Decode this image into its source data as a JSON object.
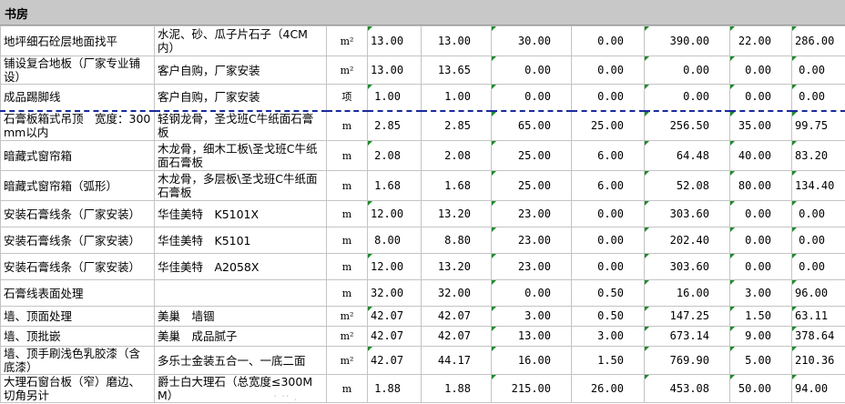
{
  "section_title": "书房",
  "rows": [
    {
      "name": "地坪细石砼层地面找平",
      "material": "水泥、砂、瓜子片石子（4CM内）",
      "unit": "m²",
      "c1": "13.00",
      "c2": "13.00",
      "c3": "30.00",
      "c4": "0.00",
      "c5": "390.00",
      "c6": "22.00",
      "c7": "286.00"
    },
    {
      "name": "铺设复合地板（厂家专业铺设）",
      "material": "客户自购，厂家安装",
      "unit": "m²",
      "c1": "13.00",
      "c2": "13.65",
      "c3": "0.00",
      "c4": "0.00",
      "c5": "0.00",
      "c6": "0.00",
      "c7": "0.00"
    },
    {
      "name": "成品踢脚线",
      "material": "客户自购，厂家安装",
      "unit": "项",
      "c1": "1.00",
      "c2": "1.00",
      "c3": "0.00",
      "c4": "0.00",
      "c5": "0.00",
      "c6": "0.00",
      "c7": "0.00"
    },
    {
      "name": "石膏板箱式吊顶　宽度：300mm以内",
      "material": "轻钢龙骨，圣戈班C牛纸面石膏板",
      "unit": "m",
      "c1": "2.85",
      "c2": "2.85",
      "c3": "65.00",
      "c4": "25.00",
      "c5": "256.50",
      "c6": "35.00",
      "c7": "99.75"
    },
    {
      "name": "暗藏式窗帘箱",
      "material": "木龙骨，细木工板\\圣戈班C牛纸面石膏板",
      "unit": "m",
      "c1": "2.08",
      "c2": "2.08",
      "c3": "25.00",
      "c4": "6.00",
      "c5": "64.48",
      "c6": "40.00",
      "c7": "83.20"
    },
    {
      "name": "暗藏式窗帘箱（弧形）",
      "material": "木龙骨，多层板\\圣戈班C牛纸面石膏板",
      "unit": "m",
      "c1": "1.68",
      "c2": "1.68",
      "c3": "25.00",
      "c4": "6.00",
      "c5": "52.08",
      "c6": "80.00",
      "c7": "134.40"
    },
    {
      "name": "安装石膏线条（厂家安装）",
      "material": "华佳美特　K5101X",
      "unit": "m",
      "c1": "12.00",
      "c2": "13.20",
      "c3": "23.00",
      "c4": "0.00",
      "c5": "303.60",
      "c6": "0.00",
      "c7": "0.00"
    },
    {
      "name": "安装石膏线条（厂家安装）",
      "material": "华佳美特　K5101",
      "unit": "m",
      "c1": "8.00",
      "c2": "8.80",
      "c3": "23.00",
      "c4": "0.00",
      "c5": "202.40",
      "c6": "0.00",
      "c7": "0.00"
    },
    {
      "name": "安装石膏线条（厂家安装）",
      "material": "华佳美特　A2058X",
      "unit": "m",
      "c1": "12.00",
      "c2": "13.20",
      "c3": "23.00",
      "c4": "0.00",
      "c5": "303.60",
      "c6": "0.00",
      "c7": "0.00"
    },
    {
      "name": "石膏线表面处理",
      "material": "",
      "unit": "m",
      "c1": "32.00",
      "c2": "32.00",
      "c3": "0.00",
      "c4": "0.50",
      "c5": "16.00",
      "c6": "3.00",
      "c7": "96.00"
    },
    {
      "name": "墙、顶面处理",
      "material": "美巢　墙锢",
      "unit": "m²",
      "c1": "42.07",
      "c2": "42.07",
      "c3": "3.00",
      "c4": "0.50",
      "c5": "147.25",
      "c6": "1.50",
      "c7": "63.11"
    },
    {
      "name": "墙、顶批嵌",
      "material": "美巢　成品腻子",
      "unit": "m²",
      "c1": "42.07",
      "c2": "42.07",
      "c3": "13.00",
      "c4": "3.00",
      "c5": "673.14",
      "c6": "9.00",
      "c7": "378.64"
    },
    {
      "name": "墙、顶手刷浅色乳胶漆（含底漆）",
      "material": "多乐士金装五合一、一底二面",
      "unit": "m²",
      "c1": "42.07",
      "c2": "44.17",
      "c3": "16.00",
      "c4": "1.50",
      "c5": "769.90",
      "c6": "5.00",
      "c7": "210.36"
    },
    {
      "name": "大理石窗台板（窄）磨边、切角另计",
      "material": "爵士白大理石（总宽度≤300MM）",
      "unit": "m",
      "c1": "1.88",
      "c2": "1.88",
      "c3": "215.00",
      "c4": "26.00",
      "c5": "453.08",
      "c6": "50.00",
      "c7": "94.00"
    }
  ]
}
